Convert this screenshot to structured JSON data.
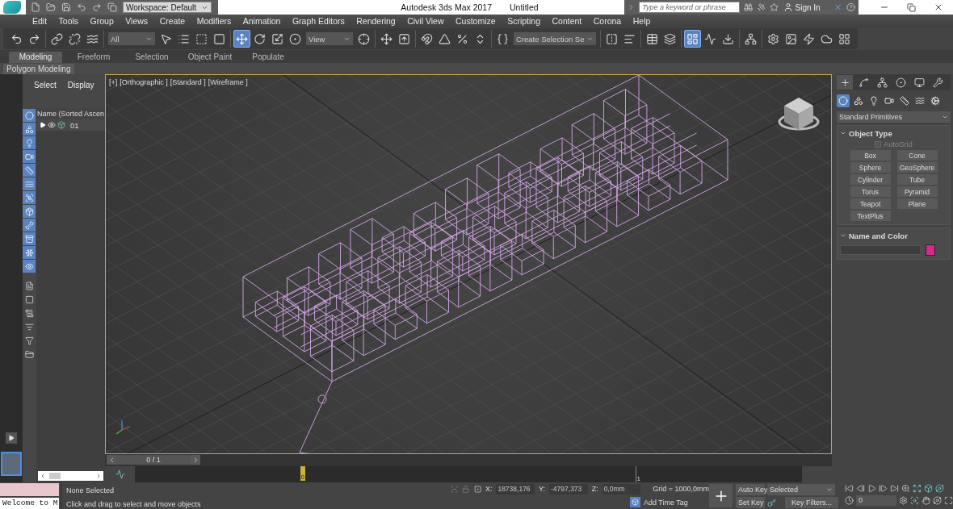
{
  "title_bar": {
    "workspace": "Workspace: Default",
    "app_name": "Autodesk 3ds Max 2017",
    "document": "Untitled",
    "search": {
      "placeholder": "Type a keyword or phrase"
    },
    "sign_in": "Sign In"
  },
  "menu": [
    "Edit",
    "Tools",
    "Group",
    "Views",
    "Create",
    "Modifiers",
    "Animation",
    "Graph Editors",
    "Rendering",
    "Civil View",
    "Customize",
    "Scripting",
    "Content",
    "Corona",
    "Help"
  ],
  "toolbar": {
    "groups": [
      [
        {
          "kind": "undo",
          "selected": false
        },
        {
          "kind": "redo",
          "selected": false
        }
      ],
      [
        {
          "kind": "link",
          "selected": false
        },
        {
          "kind": "unlink",
          "selected": false
        },
        {
          "kind": "bind",
          "selected": false
        }
      ],
      [
        {
          "kind": "dropdown",
          "value": "All"
        },
        {
          "kind": "select",
          "selected": false
        },
        {
          "kind": "select_by_name",
          "selected": false
        },
        {
          "kind": "region",
          "selected": false
        },
        {
          "kind": "crossing",
          "selected": false
        }
      ],
      [
        {
          "kind": "move",
          "selected": true
        },
        {
          "kind": "rotate",
          "selected": false
        },
        {
          "kind": "scale",
          "selected": false
        },
        {
          "kind": "placement",
          "selected": false
        },
        {
          "kind": "dropdown",
          "value": "View"
        },
        {
          "kind": "pivot",
          "selected": false
        }
      ],
      [
        {
          "kind": "manipulate",
          "selected": false
        },
        {
          "kind": "shortcut",
          "selected": false
        }
      ],
      [
        {
          "kind": "snap",
          "selected": false
        },
        {
          "kind": "angle_snap",
          "selected": false
        },
        {
          "kind": "percent_snap",
          "selected": false
        },
        {
          "kind": "spinner_snap",
          "selected": false
        }
      ],
      [
        {
          "kind": "named_sets",
          "selected": false
        },
        {
          "kind": "dropdown",
          "value": "Create Selection Se"
        }
      ],
      [
        {
          "kind": "mirror",
          "selected": false
        },
        {
          "kind": "align",
          "selected": false
        }
      ],
      [
        {
          "kind": "explorer",
          "selected": false
        },
        {
          "kind": "layers",
          "selected": false
        }
      ],
      [
        {
          "kind": "ribbon",
          "selected": true
        },
        {
          "kind": "curve_editor",
          "selected": false
        },
        {
          "kind": "dope",
          "selected": false
        }
      ],
      [
        {
          "kind": "schematic",
          "selected": false
        }
      ],
      [
        {
          "kind": "material",
          "selected": false
        },
        {
          "kind": "render_setup",
          "selected": false
        },
        {
          "kind": "render",
          "selected": false
        },
        {
          "kind": "render_cloud",
          "selected": false
        },
        {
          "kind": "layout",
          "selected": false
        }
      ]
    ]
  },
  "ribbon": {
    "tabs": [
      {
        "label": "Modeling",
        "selected": true
      },
      {
        "label": "Freeform",
        "selected": false
      },
      {
        "label": "Selection",
        "selected": false
      },
      {
        "label": "Object Paint",
        "selected": false
      },
      {
        "label": "Populate",
        "selected": false
      }
    ],
    "panel": "Polygon Modeling"
  },
  "scene_explorer": {
    "tabs": [
      "Select",
      "Display"
    ],
    "filters": [
      {
        "kind": "geometry",
        "on": true
      },
      {
        "kind": "shapes",
        "on": true
      },
      {
        "kind": "lights",
        "on": true
      },
      {
        "kind": "cameras",
        "on": true
      },
      {
        "kind": "helpers",
        "on": true
      },
      {
        "kind": "space_warps",
        "on": true
      },
      {
        "kind": "groups",
        "on": true
      },
      {
        "kind": "xrefs",
        "on": true
      },
      {
        "kind": "bones",
        "on": true
      },
      {
        "kind": "containers",
        "on": true
      },
      {
        "kind": "particles",
        "on": true
      },
      {
        "kind": "hidden",
        "on": true
      }
    ],
    "tools": [
      {
        "kind": "children"
      },
      {
        "kind": "influences"
      },
      {
        "kind": "dependents"
      },
      {
        "kind": "filter_settings"
      },
      {
        "kind": "filter"
      },
      {
        "kind": "sets"
      }
    ],
    "column": "Name (Sorted Ascen",
    "rows": [
      {
        "name": "01",
        "expanded": false
      }
    ]
  },
  "viewport": {
    "labels": [
      "[+]",
      "[Orthographic ]",
      "[Standard ]",
      "[Wireframe ]"
    ],
    "active": true
  },
  "time_slider": {
    "position": "0 / 1"
  },
  "track_bar": {
    "current_frame": "0",
    "end_frame": "1"
  },
  "command_panel": {
    "tabs": [
      {
        "kind": "create",
        "selected": true
      },
      {
        "kind": "modify",
        "selected": false
      },
      {
        "kind": "hierarchy",
        "selected": false
      },
      {
        "kind": "motion",
        "selected": false
      },
      {
        "kind": "display",
        "selected": false
      },
      {
        "kind": "utilities",
        "selected": false
      }
    ],
    "categories": [
      {
        "kind": "geometry",
        "selected": true
      },
      {
        "kind": "shapes",
        "selected": false
      },
      {
        "kind": "lights",
        "selected": false
      },
      {
        "kind": "cameras",
        "selected": false
      },
      {
        "kind": "helpers",
        "selected": false
      },
      {
        "kind": "space_warps",
        "selected": false
      },
      {
        "kind": "systems",
        "selected": false
      }
    ],
    "type_dropdown": "Standard Primitives",
    "object_type": {
      "title": "Object Type",
      "expanded": true,
      "autogrid": {
        "label": "AutoGrid",
        "checked": false,
        "disabled": true
      },
      "buttons": [
        "Box",
        "Cone",
        "Sphere",
        "GeoSphere",
        "Cylinder",
        "Tube",
        "Torus",
        "Pyramid",
        "Teapot",
        "Plane",
        "TextPlus"
      ]
    },
    "name_and_color": {
      "title": "Name and Color",
      "expanded": true,
      "color": "#d42a8c"
    }
  },
  "status_bar": {
    "listener": "Welcome to M",
    "selection": "None Selected",
    "prompt": "Click and drag to select and move objects",
    "coords": [
      {
        "label": "X:",
        "value": "18738,176"
      },
      {
        "label": "Y:",
        "value": "-4797,373"
      },
      {
        "label": "Z:",
        "value": "0,0mm"
      }
    ],
    "grid": "Grid = 1000,0mm",
    "time_tag": "Add Time Tag",
    "auto_key": "Auto Key",
    "key_mode": "Selected",
    "set_key": "Set Key",
    "key_filters": "Key Filters...",
    "frame": "0"
  }
}
